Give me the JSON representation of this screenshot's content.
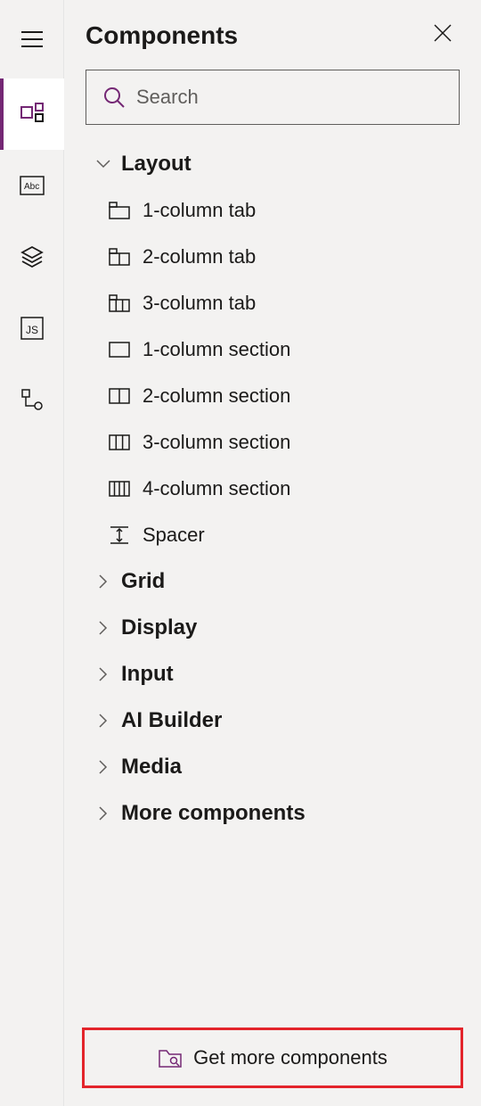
{
  "panel": {
    "title": "Components"
  },
  "search": {
    "placeholder": "Search"
  },
  "groups": {
    "layout": {
      "label": "Layout",
      "items": [
        {
          "label": "1-column tab"
        },
        {
          "label": "2-column tab"
        },
        {
          "label": "3-column tab"
        },
        {
          "label": "1-column section"
        },
        {
          "label": "2-column section"
        },
        {
          "label": "3-column section"
        },
        {
          "label": "4-column section"
        },
        {
          "label": "Spacer"
        }
      ]
    },
    "grid": {
      "label": "Grid"
    },
    "display": {
      "label": "Display"
    },
    "input": {
      "label": "Input"
    },
    "ai_builder": {
      "label": "AI Builder"
    },
    "media": {
      "label": "Media"
    },
    "more": {
      "label": "More components"
    }
  },
  "footer": {
    "label": "Get more components"
  }
}
